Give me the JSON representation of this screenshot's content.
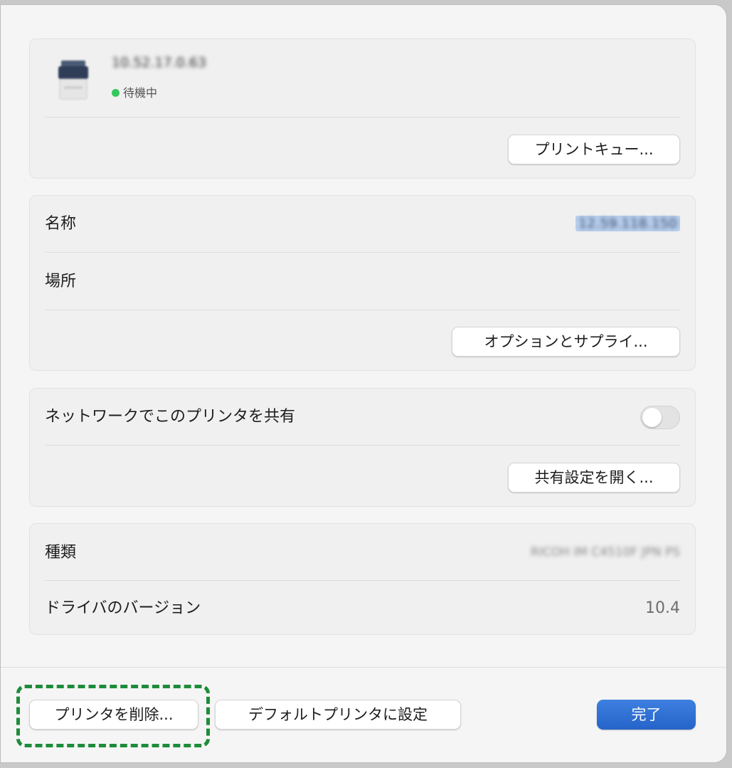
{
  "printer": {
    "name": "10.52.17.0.63",
    "status": "待機中",
    "status_color": "#34c759",
    "icon": "printer-icon",
    "print_queue_button": "プリントキュー..."
  },
  "details": {
    "name_label": "名称",
    "name_value": "12.59.118.150",
    "location_label": "場所",
    "options_button": "オプションとサプライ..."
  },
  "sharing": {
    "share_label": "ネットワークでこのプリンタを共有",
    "share_enabled": false,
    "open_sharing_button": "共有設定を開く..."
  },
  "info": {
    "kind_label": "種類",
    "kind_value": "RICOH IM C4510F JPN PS",
    "driver_label": "ドライバのバージョン",
    "driver_value": "10.4"
  },
  "footer": {
    "remove_button": "プリンタを削除...",
    "default_button": "デフォルトプリンタに設定",
    "done_button": "完了",
    "accent_color": "#2f6fd0",
    "highlight_color": "#1e8c3a"
  }
}
